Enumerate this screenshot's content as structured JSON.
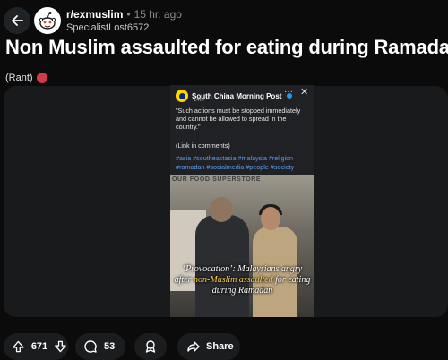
{
  "header": {
    "subreddit": "r/exmuslim",
    "separator": "•",
    "time_ago": "15 hr. ago",
    "author": "SpecialistLost6572"
  },
  "post": {
    "title": "Non Muslim assaulted for eating during Ramadan",
    "flair": "(Rant)"
  },
  "embed": {
    "source": "South China Morning Post",
    "time": "14m",
    "more_label": "···",
    "close_label": "✕",
    "text": "\"Such actions must be stopped immediately and cannot be allowed to spread in the country.\"",
    "link_note": "(Link in comments)",
    "hashtags": "#asia #southeastasia #malaysia #religion #ramadan #socialmedia #people #society",
    "store_sign": "OUR FOOD SUPERSTORE",
    "caption_a": "‘Provocation’: Malaysians angry after ",
    "caption_highlight": "non-Muslim assaulted",
    "caption_b": " for eating during Ramadan"
  },
  "actions": {
    "upvotes": "671",
    "comments": "53",
    "share_label": "Share"
  },
  "colors": {
    "background": "#0b0b0b",
    "hashtag": "#5b9cf0",
    "caption_highlight": "#ffd23f"
  },
  "icons": [
    "back-arrow-icon",
    "reddit-snoo-icon",
    "angry-emoji-icon",
    "upvote-icon",
    "downvote-icon",
    "comment-icon",
    "award-icon",
    "share-icon"
  ]
}
